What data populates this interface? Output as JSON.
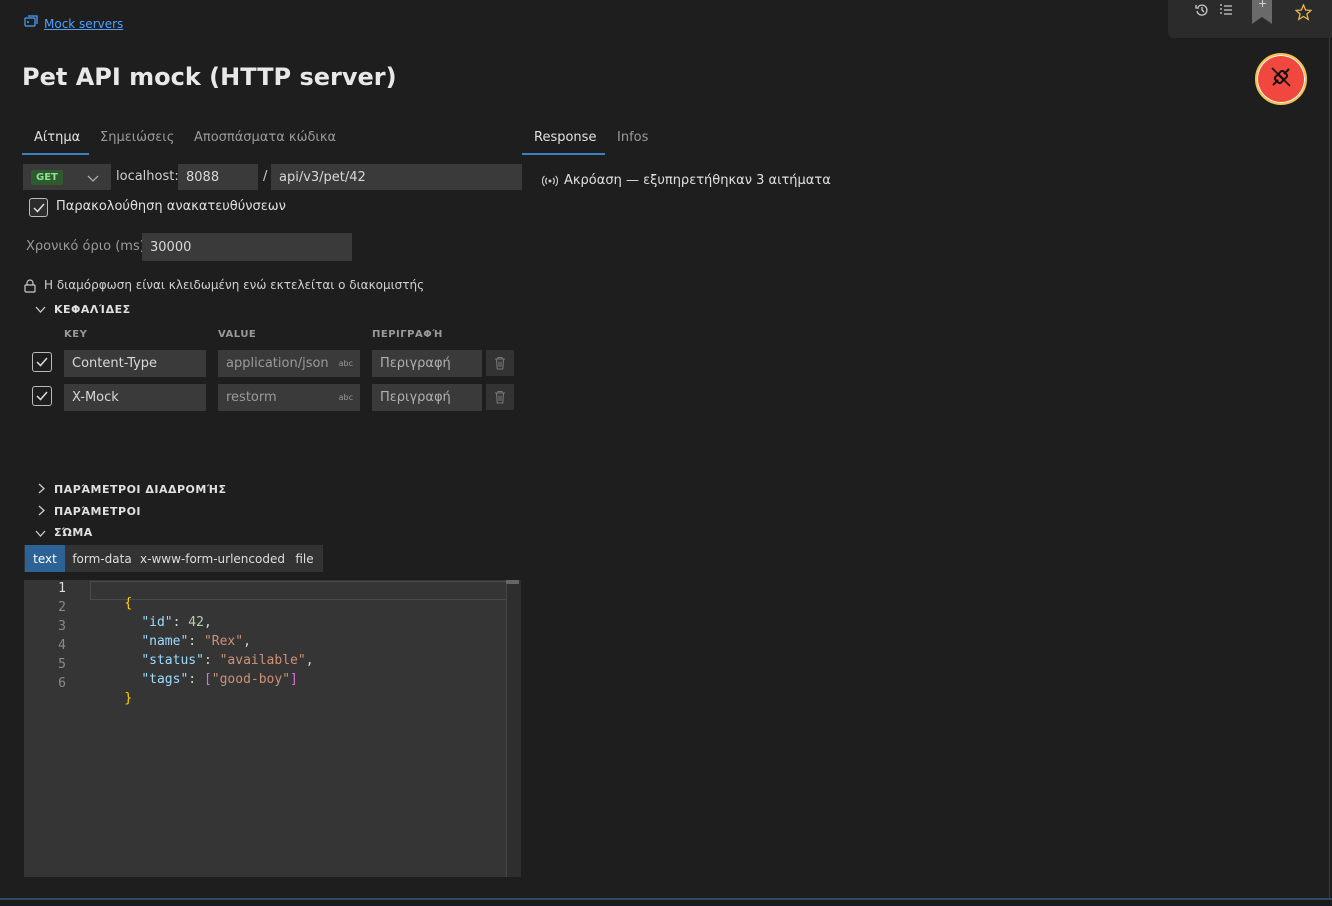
{
  "breadcrumb": {
    "label": "Mock servers"
  },
  "page": {
    "title": "Pet API mock (HTTP server)"
  },
  "request_tabs": [
    {
      "label": "Αίτημα",
      "active": true
    },
    {
      "label": "Σημειώσεις",
      "active": false
    },
    {
      "label": "Αποσπάσματα κώδικα",
      "active": false
    }
  ],
  "response_tabs": [
    {
      "label": "Response",
      "active": true
    },
    {
      "label": "Infos",
      "active": false
    }
  ],
  "request": {
    "method": "GET",
    "host_label": "localhost:",
    "port": "8088",
    "separator": "/",
    "path": "api/v3/pet/42",
    "follow_redirects_label": "Παρακολούθηση ανακατευθύνσεων",
    "follow_redirects": true,
    "timeout_label": "Χρονικό όριο (ms)",
    "timeout_value": "30000",
    "lock_message": "Η διαμόρφωση είναι κλειδωμένη ενώ εκτελείται ο διακομιστής"
  },
  "headers": {
    "section_label": "ΚΕΦΑΛΊΔΕΣ",
    "columns": [
      "KEY",
      "VALUE",
      "ΠΕΡΙΓΡΑΦΉ"
    ],
    "rows": [
      {
        "enabled": true,
        "key": "Content-Type",
        "value": "application/json",
        "type_tag": "abc",
        "description": "Περιγραφή"
      },
      {
        "enabled": true,
        "key": "X-Mock",
        "value": "restorm",
        "type_tag": "abc",
        "description": "Περιγραφή"
      }
    ]
  },
  "sections": {
    "route_params": "ΠΑΡΆΜΕΤΡΟΙ ΔΙΑΔΡΟΜΉΣ",
    "params": "ΠΑΡΆΜΕΤΡΟΙ",
    "body": "ΣΏΜΑ"
  },
  "body_tabs": [
    {
      "label": "text",
      "active": true
    },
    {
      "label": "form-data",
      "active": false
    },
    {
      "label": "x-www-form-urlencoded",
      "active": false
    },
    {
      "label": "file",
      "active": false
    }
  ],
  "editor": {
    "line_numbers": [
      "1",
      "2",
      "3",
      "4",
      "5",
      "6"
    ],
    "lines": {
      "l1": "{",
      "l2_key": "\"id\"",
      "l2_colon": ": ",
      "l2_val": "42",
      "l2_end": ",",
      "l3_key": "\"name\"",
      "l3_colon": ": ",
      "l3_val": "\"Rex\"",
      "l3_end": ",",
      "l4_key": "\"status\"",
      "l4_colon": ": ",
      "l4_val": "\"available\"",
      "l4_end": ",",
      "l5_key": "\"tags\"",
      "l5_colon": ": ",
      "l5_open": "[",
      "l5_val": "\"good-boy\"",
      "l5_close": "]",
      "l6": "}"
    }
  },
  "response": {
    "status": "Ακρόαση — εξυπηρετήθηκαν 3 αιτήματα"
  },
  "toolbar": {
    "bookmark_plus": "+"
  },
  "colors": {
    "accent": "#3b7fc4",
    "stop_button": "#f0473e",
    "method_get": "#6fcf6f"
  }
}
